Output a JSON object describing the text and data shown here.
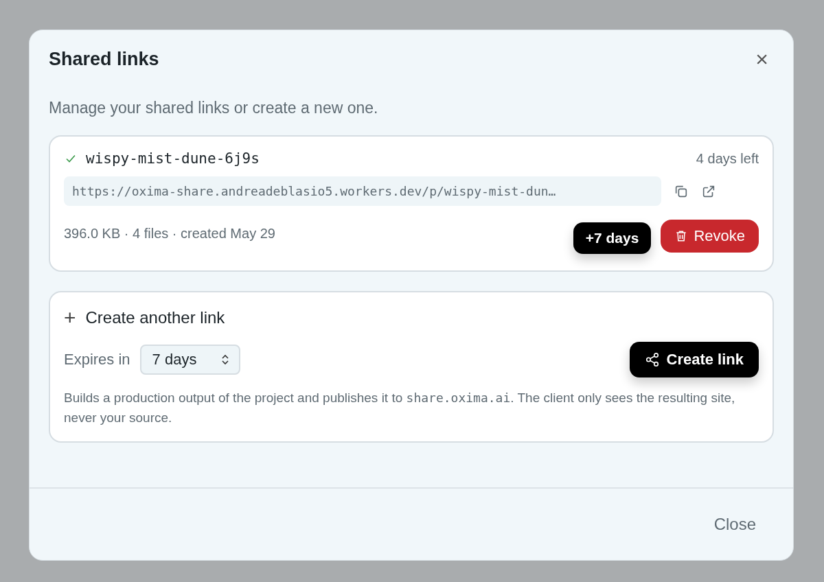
{
  "dialog": {
    "title": "Shared links",
    "close_icon": "×",
    "subtitle": "Manage your shared links or create a new one."
  },
  "links": [
    {
      "name": "wispy-mist-dune-6j9s",
      "active": true,
      "remaining": "4 days left",
      "url": "https://oxima-share.andreadeblasio5.workers.dev/p/wispy-mist-dun…",
      "meta": "396.0 KB · 4 files · created May 29",
      "extend_label": "+7 days",
      "revoke_label": "Revoke"
    }
  ],
  "create": {
    "icon": "+",
    "title": "Create another link",
    "expires_label": "Expires in",
    "expires_value": "7 days",
    "button": "Create link",
    "description": {
      "before": "Builds a production output of the project and publishes it to ",
      "code": "share.oxima.ai",
      "after": ". The client only sees the resulting site, never your source."
    }
  },
  "footer": {
    "close": "Close"
  }
}
